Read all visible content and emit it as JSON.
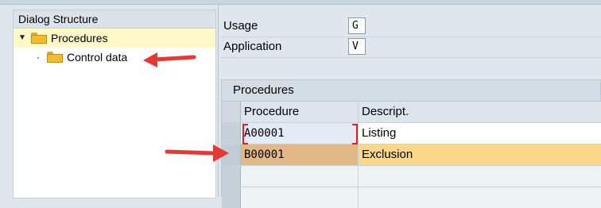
{
  "tree": {
    "header": "Dialog Structure",
    "items": [
      {
        "label": "Procedures",
        "expander": "▼",
        "selected": true
      },
      {
        "label": "Control data",
        "bullet": "·"
      }
    ]
  },
  "fields": [
    {
      "label": "Usage",
      "value": "G"
    },
    {
      "label": "Application",
      "value": "V"
    }
  ],
  "table": {
    "title": "Procedures",
    "columns": [
      "Procedure",
      "Descript."
    ],
    "rows": [
      {
        "procedure": "A00001",
        "description": "Listing"
      },
      {
        "procedure": "B00001",
        "description": "Exclusion"
      }
    ]
  },
  "colors": {
    "selected_row": "#fbd889",
    "annotation_arrow": "#e53935",
    "tree_selected": "#fff9c9"
  },
  "icons": [
    "folder-icon",
    "red-arrow-annotation"
  ]
}
